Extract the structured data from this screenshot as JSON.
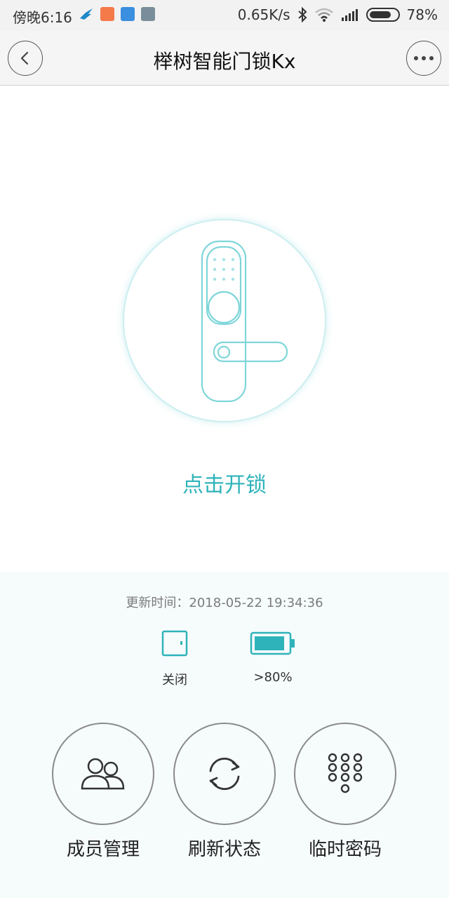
{
  "status_bar": {
    "time": "傍晚6:16",
    "network_speed": "0.65K/s",
    "battery": "78%",
    "battery_level": 0.78
  },
  "header": {
    "title": "榉树智能门锁Kx",
    "back_icon": "chevron-left-icon",
    "more_icon": "more-dots-icon"
  },
  "lock": {
    "action_label": "点击开锁",
    "icon": "door-lock-illustration"
  },
  "status": {
    "update_time": "更新时间：2018-05-22 19:34:36",
    "door_label": "关闭",
    "battery_label": ">80%",
    "battery_level": 0.8
  },
  "actions": [
    {
      "label": "成员管理",
      "icon": "members-icon"
    },
    {
      "label": "刷新状态",
      "icon": "refresh-icon"
    },
    {
      "label": "临时密码",
      "icon": "keypad-icon"
    }
  ],
  "colors": {
    "accent": "#2fb3ba",
    "panel_bg": "#f6fbfc"
  }
}
